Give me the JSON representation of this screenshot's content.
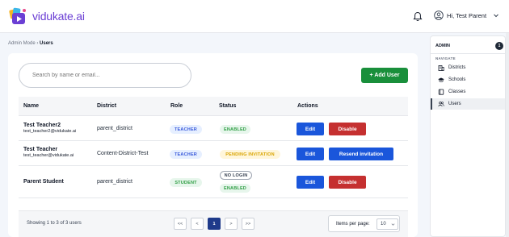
{
  "app": {
    "logo_text": "vidukate.ai",
    "user_greeting": "Hi, Test Parent"
  },
  "breadcrumb": {
    "parent": "Admin Mode",
    "separator": "›",
    "current": "Users"
  },
  "search": {
    "placeholder": "Search by name or email..."
  },
  "actions": {
    "add_user": "+ Add User"
  },
  "table": {
    "headers": [
      "Name",
      "District",
      "Role",
      "Status",
      "Actions"
    ],
    "rows": [
      {
        "name": "Test Teacher2",
        "email": "test_teacher2@vidukate.ai",
        "district": "parent_district",
        "role": "TEACHER",
        "status": [
          "ENABLED"
        ],
        "buttons": [
          "Edit",
          "Disable"
        ]
      },
      {
        "name": "Test Teacher",
        "email": "test_teacher@vidukate.ai",
        "district": "Content-District-Test",
        "role": "TEACHER",
        "status": [
          "PENDING INVITATION"
        ],
        "buttons": [
          "Edit",
          "Resend invitation"
        ]
      },
      {
        "name": "Parent Student",
        "email": "",
        "district": "parent_district",
        "role": "STUDENT",
        "status": [
          "NO LOGIN",
          "ENABLED"
        ],
        "buttons": [
          "Edit",
          "Disable"
        ]
      }
    ]
  },
  "pagination": {
    "showing": "Showing 1 to 3 of 3 users",
    "first": "<<",
    "prev": "<",
    "page": "1",
    "next": ">",
    "last": ">>",
    "items_per_page_label": "Items per page:",
    "items_per_page_value": "10"
  },
  "sidebar": {
    "header": "ADMIN",
    "count": "1",
    "section": "NAVIGATE",
    "items": [
      {
        "label": "Districts",
        "icon": "building-icon"
      },
      {
        "label": "Schools",
        "icon": "graduation-cap-icon"
      },
      {
        "label": "Classes",
        "icon": "book-icon"
      },
      {
        "label": "Users",
        "icon": "users-icon",
        "active": true
      }
    ]
  },
  "colors": {
    "brand": "#6b3fd4",
    "primary": "#1a56db",
    "success": "#198f3b",
    "danger": "#c53030"
  }
}
